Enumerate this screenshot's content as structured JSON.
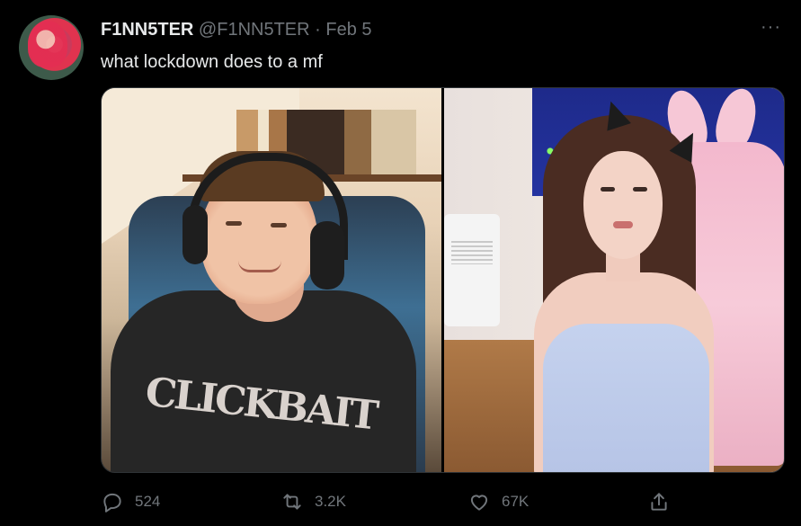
{
  "tweet": {
    "display_name": "F1NN5TER",
    "handle": "@F1NN5TER",
    "separator": "·",
    "date": "Feb 5",
    "text": "what lockdown does to a mf",
    "more_icon": "more-horizontal-icon",
    "more_label": "···"
  },
  "media": {
    "left_photo_print": "CLICKBAIT",
    "photos": [
      "photo-left",
      "photo-right"
    ]
  },
  "actions": {
    "reply": {
      "icon": "reply-bubble-icon",
      "count": "524"
    },
    "retweet": {
      "icon": "retweet-icon",
      "count": "3.2K"
    },
    "like": {
      "icon": "heart-icon",
      "count": "67K"
    },
    "share": {
      "icon": "share-icon"
    }
  },
  "colors": {
    "background": "#000000",
    "text_primary": "#e7e9ea",
    "text_secondary": "#71767b"
  }
}
